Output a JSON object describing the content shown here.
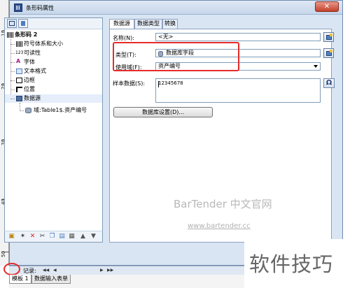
{
  "window": {
    "title": "条形码属性"
  },
  "ruler": {
    "labels": [
      "10",
      "20",
      "30",
      "40",
      "50"
    ]
  },
  "tree": {
    "root": "条形码 2",
    "items": [
      {
        "label": "符号体系和大小",
        "icon": "barcode-icon"
      },
      {
        "label": "可读性",
        "icon": "readable-123-icon",
        "prefix": "123"
      },
      {
        "label": "字体",
        "icon": "font-icon"
      },
      {
        "label": "文本格式",
        "icon": "text-format-icon"
      },
      {
        "label": "边框",
        "icon": "border-icon"
      },
      {
        "label": "位置",
        "icon": "position-icon"
      },
      {
        "label": "数据源",
        "icon": "datasource-icon"
      }
    ],
    "child": "域:Table1$.资产编号"
  },
  "tabs": [
    {
      "label": "数据源",
      "active": true
    },
    {
      "label": "数据类型",
      "active": false
    },
    {
      "label": "转换",
      "active": false
    }
  ],
  "form": {
    "name_label": "名称(N):",
    "name_value": "<无>",
    "type_label": "类型(T):",
    "type_value": "数据库字段",
    "field_label": "使用域(F):",
    "field_value": "资产编号",
    "sample_label": "样本数据(S):",
    "sample_value": "12345678",
    "omega": "Ω",
    "db_button": "数据库设置(D)..."
  },
  "watermark": {
    "brand": "BarTender 中文官网",
    "url": "www.bartender.cc"
  },
  "status": {
    "record_label": "记录:",
    "nav_first": "◀◀",
    "nav_prev": "◀",
    "nav_next": "▶",
    "nav_last": "▶▶"
  },
  "sheet_tabs": [
    "模板 1",
    "数据输入表单"
  ],
  "overlay": "软件技巧",
  "colors": {
    "highlight": "#e52b2b",
    "window_bg": "#d9e5f3"
  }
}
